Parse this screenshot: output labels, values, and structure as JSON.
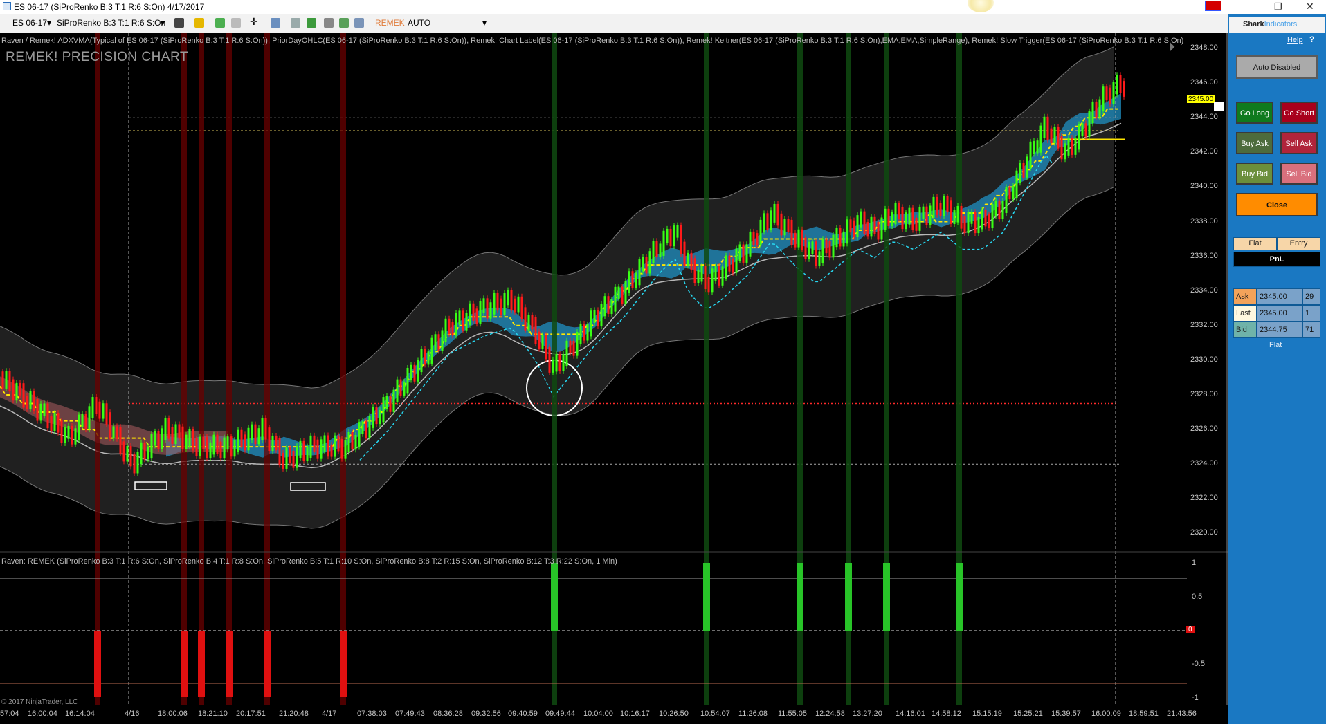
{
  "window": {
    "title": "ES 06-17 (SiProRenko B:3 T:1 R:6 S:On)  4/17/2017",
    "minimize_icon": "minimize-icon",
    "maximize_icon": "restore-icon",
    "close_icon": "close-icon"
  },
  "toolbar": {
    "instrument": "ES 06-17",
    "bar_type": "SiProRenko B:3 T:1 R:6 S:On",
    "remek_label": "REMEK",
    "auto_label": "AUTO"
  },
  "chart": {
    "indicator_header": "Raven / Remek! ADXVMA(Typical of ES 06-17 (SiProRenko B:3 T:1 R:6 S:On)), PriorDayOHLC(ES 06-17 (SiProRenko B:3 T:1 R:6 S:On)), Remek! Chart Label(ES 06-17 (SiProRenko B:3 T:1 R:6 S:On)), Remek! Keltner(ES 06-17 (SiProRenko B:3 T:1 R:6 S:On),EMA,EMA,SimpleRange), Remek! Slow Trigger(ES 06-17 (SiProRenko B:3 T:1 R:6 S:On)",
    "chart_label": "REMEK! PRECISION CHART",
    "current_price": "2345.00",
    "price_ticks": [
      "2348.00",
      "2346.00",
      "2344.00",
      "2342.00",
      "2340.00",
      "2338.00",
      "2336.00",
      "2334.00",
      "2332.00",
      "2330.00",
      "2328.00",
      "2326.00",
      "2324.00",
      "2322.00",
      "2320.00"
    ],
    "lower_header": "Raven: REMEK (SiProRenko B:3 T:1 R:6 S:On, SiProRenko B:4 T:1 R:8 S:On, SiProRenko B:5 T:1 R:10 S:On, SiProRenko B:8 T:2 R:15 S:On, SiProRenko B:12 T:3 R:22 S:On, 1 Min)",
    "lower_ticks": [
      "1",
      "0.5",
      "-0.5",
      "-1"
    ],
    "lower_zero": "0",
    "copyright": "© 2017 NinjaTrader, LLC",
    "time_labels": [
      "57:04",
      "16:00:04",
      "16:14:04",
      "4/16",
      "18:00:06",
      "18:21:10",
      "20:17:51",
      "21:20:48",
      "4/17",
      "07:38:03",
      "07:49:43",
      "08:36:28",
      "09:32:56",
      "09:40:59",
      "09:49:44",
      "10:04:00",
      "10:16:17",
      "10:26:50",
      "10:54:07",
      "11:26:08",
      "11:55:05",
      "12:24:58",
      "13:27:20",
      "14:16:01",
      "14:58:12",
      "15:15:19",
      "15:25:21",
      "15:39:57",
      "16:00:09",
      "18:59:51",
      "21:43:56"
    ]
  },
  "panel": {
    "logo_prefix": "Shark",
    "logo_suffix": "Indicators",
    "help": "Help",
    "help_q": "?",
    "auto_btn": "Auto Disabled",
    "go_long": "Go Long",
    "go_short": "Go Short",
    "buy_ask": "Buy Ask",
    "sell_ask": "Sell Ask",
    "buy_bid": "Buy Bid",
    "sell_bid": "Sell Bid",
    "close": "Close",
    "flat_hdr": "Flat",
    "entry_hdr": "Entry",
    "pnl": "PnL",
    "ask_label": "Ask",
    "ask_price": "2345.00",
    "ask_size": "29",
    "last_label": "Last",
    "last_price": "2345.00",
    "last_size": "1",
    "bid_label": "Bid",
    "bid_price": "2344.75",
    "bid_size": "71",
    "position": "Flat"
  },
  "colors": {
    "up_bar": "#39ff14",
    "down_bar": "#ff1a1a",
    "cloud": "#1f8fc2",
    "band": "#3a3a3a",
    "signal_up": "#28c428",
    "signal_down": "#e01010",
    "panel_bg": "#1a78c2"
  }
}
